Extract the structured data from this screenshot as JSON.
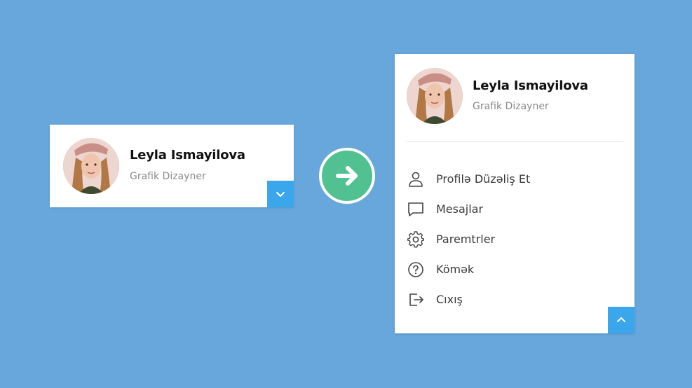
{
  "profile": {
    "name": "Leyla Ismayilova",
    "role": "Grafik Dizayner"
  },
  "menu": {
    "items": [
      {
        "label": "Profilə Düzəliş Et",
        "icon": "user-icon"
      },
      {
        "label": "Mesajlar",
        "icon": "message-icon"
      },
      {
        "label": "Paremtrler",
        "icon": "gear-icon"
      },
      {
        "label": "Kömək",
        "icon": "help-icon"
      },
      {
        "label": "Cıxış",
        "icon": "logout-icon"
      }
    ]
  },
  "colors": {
    "background": "#68a7dc",
    "toggle_button": "#3aa7ec",
    "arrow_circle": "#52c192",
    "card": "#ffffff"
  },
  "icons": {
    "collapsed_toggle": "chevron-down-icon",
    "expanded_toggle": "chevron-up-icon",
    "transition": "arrow-right-icon"
  }
}
